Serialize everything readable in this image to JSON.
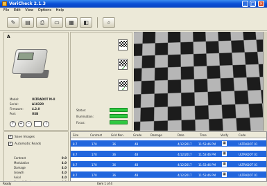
{
  "window": {
    "title": "VeriCheck 2.1.3",
    "minimize": "_",
    "maximize": "□",
    "close": "×"
  },
  "menu": [
    "File",
    "Edit",
    "View",
    "Options",
    "Help"
  ],
  "toolbar": {
    "buttons": [
      {
        "name": "new-icon",
        "glyph": "✎"
      },
      {
        "name": "save-icon",
        "glyph": "▤"
      },
      {
        "name": "print-icon",
        "glyph": "⎙"
      },
      {
        "name": "folder-icon",
        "glyph": "▭"
      },
      {
        "name": "scanner-icon",
        "glyph": "▦"
      },
      {
        "name": "camera-icon",
        "glyph": "◧"
      },
      {
        "name": "search-icon",
        "glyph": "⌕"
      }
    ]
  },
  "device": {
    "label": "A",
    "info": [
      {
        "k": "Model:",
        "v": "ULTRADOT M-II"
      },
      {
        "k": "Serial:",
        "v": "A18320"
      },
      {
        "k": "Firmware:",
        "v": "4.2.0"
      },
      {
        "k": "Port:",
        "v": "USB"
      }
    ],
    "round_buttons": [
      "?",
      "+",
      "-",
      "i"
    ]
  },
  "stats": [
    {
      "label": "Status:",
      "color": "#2ec840"
    },
    {
      "label": "Illumination:",
      "color": "#2ec840"
    },
    {
      "label": "Focus:",
      "color": "#2ec840"
    }
  ],
  "options": {
    "check_one": {
      "label": "Save Images",
      "checked": true
    },
    "check_two": {
      "label": "Automatic Reads",
      "checked": true
    }
  },
  "params": [
    {
      "k": "Contrast",
      "v": "0.0"
    },
    {
      "k": "Modulation",
      "v": "4.0"
    },
    {
      "k": "Damage",
      "v": "4.0"
    },
    {
      "k": "Growth",
      "v": "4.0"
    },
    {
      "k": "Axial",
      "v": "4.0"
    },
    {
      "k": "Overall Grade",
      "v": "4.0"
    }
  ],
  "grid": {
    "headers": [
      "Size",
      "Contrast",
      "Grid Non.",
      "Grade",
      "Damage",
      "Date",
      "Time",
      "Verify",
      "Code"
    ],
    "rows": [
      [
        "8.7",
        "170",
        "36",
        "4B",
        "",
        "4/12/2017",
        "11:53:46 PM",
        "▦",
        "ULTRADOT 01"
      ],
      [
        "8.7",
        "170",
        "36",
        "4B",
        "",
        "4/12/2017",
        "11:53:46 PM",
        "▦",
        "ULTRADOT 01"
      ],
      [
        "8.7",
        "170",
        "36",
        "4B",
        "",
        "4/12/2017",
        "11:53:46 PM",
        "▦",
        "ULTRADOT 01"
      ],
      [
        "8.7",
        "170",
        "36",
        "4B",
        "",
        "4/12/2017",
        "11:53:46 PM",
        "▦",
        "ULTRADOT 01"
      ]
    ]
  },
  "status": {
    "left": "Ready",
    "middle": "Item 1 of 4"
  }
}
